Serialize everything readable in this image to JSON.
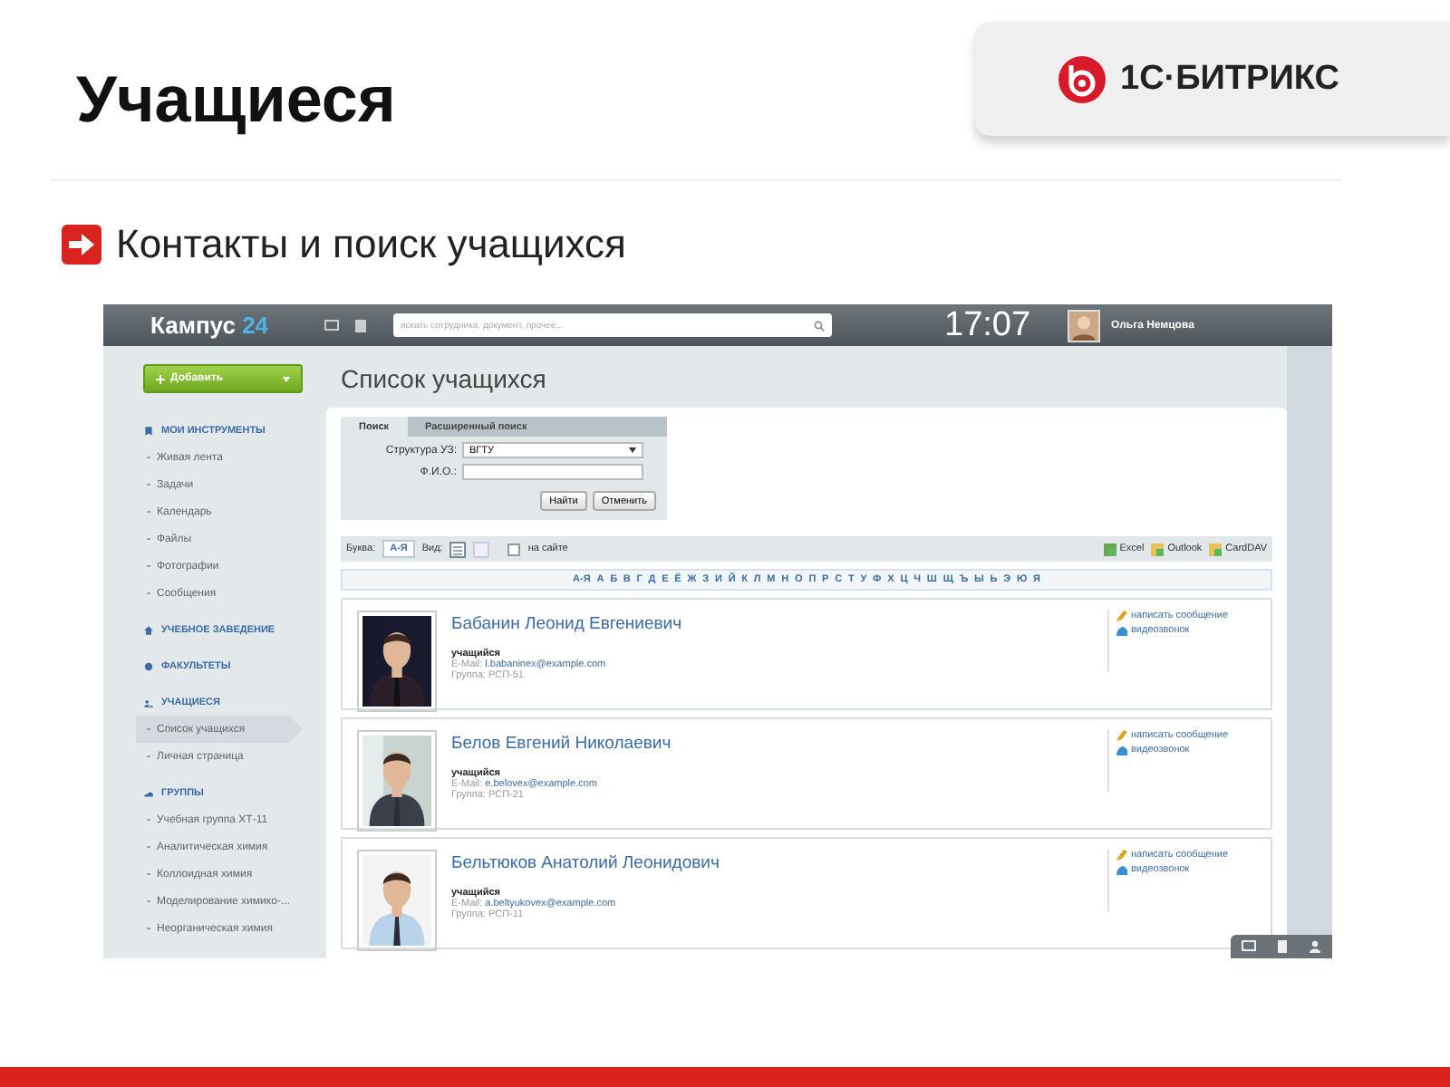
{
  "slide": {
    "title": "Учащиеся",
    "logo_text": "1С·БИТРИКС",
    "bullet": "Контакты и поиск учащихся"
  },
  "app": {
    "header": {
      "logo": "Кампус",
      "logo_number": "24",
      "search_placeholder": "искать сотрудника, документ, прочее...",
      "time": "17:07",
      "user_name": "Ольга Немцова"
    },
    "add_button": "Добавить",
    "sidebar": [
      {
        "title": "МОИ ИНСТРУМЕНТЫ",
        "kind": "bookmark",
        "items": [
          {
            "label": "Живая лента",
            "selected": false
          },
          {
            "label": "Задачи",
            "selected": false
          },
          {
            "label": "Календарь",
            "selected": false
          },
          {
            "label": "Файлы",
            "selected": false
          },
          {
            "label": "Фотографии",
            "selected": false
          },
          {
            "label": "Сообщения",
            "selected": false
          }
        ]
      },
      {
        "title": "УЧЕБНОЕ ЗАВЕДЕНИЕ",
        "kind": "house"
      },
      {
        "title": "ФАКУЛЬТЕТЫ",
        "kind": "gear"
      },
      {
        "title": "УЧАЩИЕСЯ",
        "kind": "people",
        "items": [
          {
            "label": "Список учащихся",
            "selected": true
          },
          {
            "label": "Личная страница",
            "selected": false
          }
        ]
      },
      {
        "title": "ГРУППЫ",
        "kind": "cloud",
        "items": [
          {
            "label": "Учебная группа ХТ-11",
            "selected": false
          },
          {
            "label": "Аналитическая химия",
            "selected": false
          },
          {
            "label": "Коллоидная химия",
            "selected": false
          },
          {
            "label": "Моделирование химико-...",
            "selected": false
          },
          {
            "label": "Неорганическая химия",
            "selected": false
          }
        ]
      }
    ],
    "page_title": "Список учащихся",
    "search_tabs": [
      {
        "label": "Поиск",
        "selected": true
      },
      {
        "label": "Расширенный поиск",
        "selected": false
      }
    ],
    "fields": [
      {
        "label": "Структура УЗ:",
        "kind": "select",
        "value": "ВГТУ"
      },
      {
        "label": "Ф.И.О.:",
        "kind": "text"
      }
    ],
    "form_buttons": [
      "Найти",
      "Отменить"
    ],
    "toolbar": {
      "letter_label": "Буква:",
      "letter_button": "А-Я",
      "view_label": "Вид:",
      "online": {
        "label": "на сайте",
        "checked": false
      },
      "exports": [
        "Excel",
        "Outlook",
        "CardDAV"
      ]
    },
    "alphabet": [
      "А-Я",
      "А",
      "Б",
      "В",
      "Г",
      "Д",
      "Е",
      "Ё",
      "Ж",
      "З",
      "И",
      "Й",
      "К",
      "Л",
      "М",
      "Н",
      "О",
      "П",
      "Р",
      "С",
      "Т",
      "У",
      "Ф",
      "Х",
      "Ц",
      "Ч",
      "Ш",
      "Щ",
      "Ъ",
      "Ы",
      "Ь",
      "Э",
      "Ю",
      "Я"
    ],
    "students": [
      {
        "name": "Бабанин Леонид Евгениевич",
        "role": "учащийся",
        "email_label": "E-Mail:",
        "email": "l.babaninex@example.com",
        "group": "Группа: РСП-51",
        "actions": [
          "написать сообщение",
          "видеозвонок"
        ]
      },
      {
        "name": "Белов Евгений Николаевич",
        "role": "учащийся",
        "email_label": "E-Mail:",
        "email": "e.belovex@example.com",
        "group": "Группа: РСП-21",
        "actions": [
          "написать сообщение",
          "видеозвонок"
        ]
      },
      {
        "name": "Бельтюков Анатолий Леонидович",
        "role": "учащийся",
        "email_label": "E-Mail:",
        "email": "a.beltyukovex@example.com",
        "group": "Группа: РСП-11",
        "actions": [
          "написать сообщение",
          "видеозвонок"
        ]
      }
    ]
  }
}
